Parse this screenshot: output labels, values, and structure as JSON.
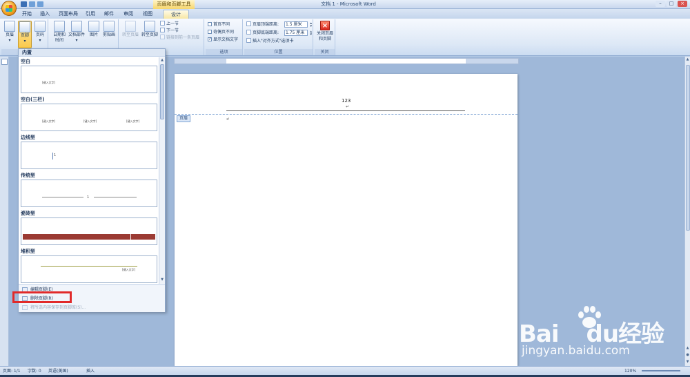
{
  "titlebar": {
    "contextual_tab_title": "页眉和页脚工具",
    "document_title": "文档 1 - Microsoft Word"
  },
  "tabs": [
    "开始",
    "插入",
    "页面布局",
    "引用",
    "邮件",
    "审阅",
    "视图",
    "设计"
  ],
  "ribbon": {
    "header_button": "页眉",
    "footer_button": "页脚",
    "page_number_button": "页码",
    "date_time_button_l1": "日期和",
    "date_time_button_l2": "时间",
    "quick_parts_button": "文档部件",
    "picture_button": "图片",
    "clip_art_button": "剪贴画",
    "goto_header_button": "转至页眉",
    "goto_footer_button": "转至页脚",
    "prev_section": "上一节",
    "next_section": "下一节",
    "link_previous": "链接到前一条页眉",
    "group_header_footer": "页",
    "group_options": "选项",
    "group_position": "位置",
    "group_close": "关闭",
    "option_diff_first": "首页不同",
    "option_diff_odd_even": "奇偶页不同",
    "option_show_text": "显示文档文字",
    "header_from_top_label": "页眉顶端距离:",
    "header_from_top_value": "1.5 厘米",
    "footer_from_bottom_label": "页脚底端距离:",
    "footer_from_bottom_value": "1.75 厘米",
    "insert_alignment_tab": "插入\"对齐方式\"选项卡",
    "close_button_l1": "关闭页眉",
    "close_button_l2": "和页脚"
  },
  "gallery": {
    "header": "内置",
    "items": [
      {
        "name": "空白"
      },
      {
        "name": "空白(三栏)"
      },
      {
        "name": "边线型"
      },
      {
        "name": "传统型"
      },
      {
        "name": "瓷砖型"
      },
      {
        "name": "堆积型"
      }
    ],
    "menu": {
      "edit_footer": "编辑页脚(E)",
      "remove_footer": "删除页脚(R)",
      "save_selection": "将所选内容保存到页脚库(S)..."
    }
  },
  "document": {
    "header_text": "123",
    "header_tag": "页眉"
  },
  "statusbar": {
    "page": "页面: 1/1",
    "words": "字数: 0",
    "language": "英语(美国)",
    "mode": "插入",
    "zoom": "120%"
  },
  "watermark": {
    "brand_left": "Bai",
    "brand_right": "du经验",
    "url": "jingyan.baidu.com"
  }
}
